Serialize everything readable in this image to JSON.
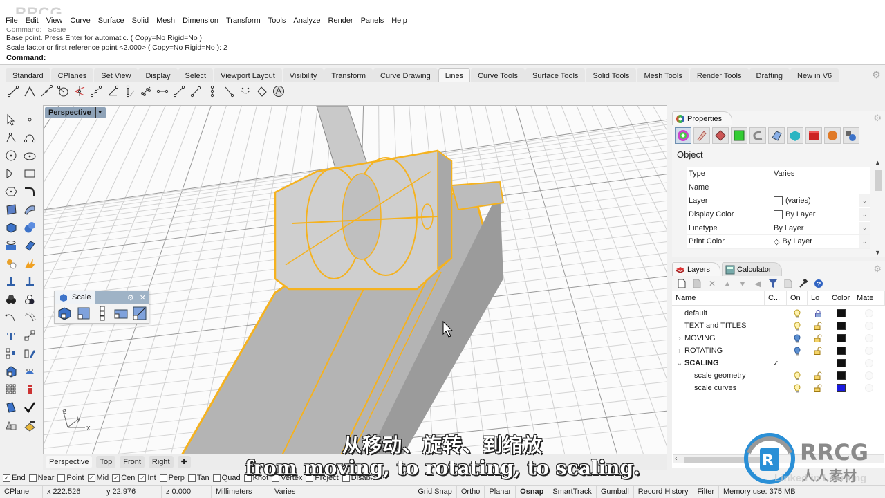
{
  "menu": [
    "File",
    "Edit",
    "View",
    "Curve",
    "Surface",
    "Solid",
    "Mesh",
    "Dimension",
    "Transform",
    "Tools",
    "Analyze",
    "Render",
    "Panels",
    "Help"
  ],
  "command": {
    "history_faded": "Command: _Scale",
    "line1": "Base point. Press Enter for automatic. ( Copy=No  Rigid=No )",
    "line2": "Scale factor or first reference point <2.000> ( Copy=No  Rigid=No ): 2",
    "prompt": "Command:",
    "value": ""
  },
  "toolbar_tabs": [
    "Standard",
    "CPlanes",
    "Set View",
    "Display",
    "Select",
    "Viewport Layout",
    "Visibility",
    "Transform",
    "Curve Drawing",
    "Lines",
    "Curve Tools",
    "Surface Tools",
    "Solid Tools",
    "Mesh Tools",
    "Render Tools",
    "Drafting",
    "New in V6"
  ],
  "active_toolbar_tab": "Lines",
  "line_tools": [
    "line-icon",
    "polyline-icon",
    "line-from-midpoint-icon",
    "line-tangent-circle-icon",
    "line-bisector-icon",
    "line-perpendicular-icon",
    "line-angled-icon",
    "line-vertical-icon",
    "line-fit-points-icon",
    "line-extend-icon",
    "line-tangent-icon",
    "line-normal-icon",
    "line-surface-normal-icon",
    "line-angle-icon",
    "polyline-on-mesh-icon",
    "convert-to-polyline-icon",
    "sphere-lines-icon"
  ],
  "viewport": {
    "title": "Perspective",
    "tabs": [
      "Perspective",
      "Top",
      "Front",
      "Right"
    ],
    "active_tab": "Perspective",
    "axes": {
      "x": "x",
      "y": "y",
      "z": "z"
    }
  },
  "scale_panel": {
    "title": "Scale",
    "tools": [
      "scale-3d-icon",
      "scale-2d-icon",
      "scale-1d-icon",
      "scale-nonuniform-icon",
      "scale-by-reference-icon"
    ]
  },
  "properties": {
    "tab": "Properties",
    "section": "Object",
    "rows": [
      {
        "key": "Type",
        "value": "Varies",
        "swatch": "none",
        "dropdown": false
      },
      {
        "key": "Name",
        "value": "",
        "swatch": "none",
        "dropdown": false
      },
      {
        "key": "Layer",
        "value": "(varies)",
        "swatch": "box",
        "dropdown": true
      },
      {
        "key": "Display Color",
        "value": "By Layer",
        "swatch": "box",
        "dropdown": true
      },
      {
        "key": "Linetype",
        "value": "By Layer",
        "swatch": "none",
        "dropdown": true
      },
      {
        "key": "Print Color",
        "value": "By Layer",
        "swatch": "diamond",
        "dropdown": true
      }
    ]
  },
  "layers": {
    "tabs": [
      "Layers",
      "Calculator"
    ],
    "columns": [
      "Name",
      "C...",
      "On",
      "Lo",
      "Color",
      "Mate"
    ],
    "rows": [
      {
        "name": "default",
        "indent": 0,
        "expander": "",
        "current": false,
        "on": "yellow",
        "lock": "locked",
        "color": "#111111"
      },
      {
        "name": "TEXT and TITLES",
        "indent": 0,
        "expander": "",
        "current": false,
        "on": "yellow",
        "lock": "unlocked",
        "color": "#111111"
      },
      {
        "name": "MOVING",
        "indent": 0,
        "expander": ">",
        "current": false,
        "on": "blue",
        "lock": "unlocked",
        "color": "#111111"
      },
      {
        "name": "ROTATING",
        "indent": 0,
        "expander": ">",
        "current": false,
        "on": "blue",
        "lock": "unlocked",
        "color": "#111111"
      },
      {
        "name": "SCALING",
        "indent": 0,
        "expander": "v",
        "current": true,
        "on": "none",
        "lock": "none",
        "color": "#111111"
      },
      {
        "name": "scale geometry",
        "indent": 1,
        "expander": "",
        "current": false,
        "on": "yellow",
        "lock": "unlocked",
        "color": "#111111"
      },
      {
        "name": "scale curves",
        "indent": 1,
        "expander": "",
        "current": false,
        "on": "yellow",
        "lock": "unlocked",
        "color": "#1a1adf"
      }
    ],
    "checkmark": "✓"
  },
  "osnap": [
    {
      "label": "End",
      "checked": true
    },
    {
      "label": "Near",
      "checked": false
    },
    {
      "label": "Point",
      "checked": false
    },
    {
      "label": "Mid",
      "checked": true
    },
    {
      "label": "Cen",
      "checked": true
    },
    {
      "label": "Int",
      "checked": true
    },
    {
      "label": "Perp",
      "checked": false
    },
    {
      "label": "Tan",
      "checked": false
    },
    {
      "label": "Quad",
      "checked": false
    },
    {
      "label": "Knot",
      "checked": false
    },
    {
      "label": "Vertex",
      "checked": false
    },
    {
      "label": "Project",
      "checked": false
    },
    {
      "label": "Disable",
      "checked": false
    }
  ],
  "status": {
    "cplane": "CPlane",
    "x": "x 222.526",
    "y": "y 22.976",
    "z": "z 0.000",
    "units": "Millimeters",
    "layer": "Varies",
    "toggles": [
      "Grid Snap",
      "Ortho",
      "Planar",
      "Osnap",
      "SmartTrack",
      "Gumball",
      "Record History",
      "Filter"
    ],
    "active_toggle": "Osnap",
    "memory": "Memory use: 375 MB"
  },
  "subtitles": {
    "cn": "从移动、旋转、到缩放",
    "en": "from moving, to rotating, to scaling."
  },
  "watermark": {
    "top_left": "RRCG",
    "logo_text": "RRCG",
    "logo_sub": "人人素材",
    "linkedin": "Linked in Learning"
  },
  "colors": {
    "selection": "#f5b21f",
    "viewport_title_bg": "#8fa3b8",
    "layer_blue": "#1a1adf"
  }
}
